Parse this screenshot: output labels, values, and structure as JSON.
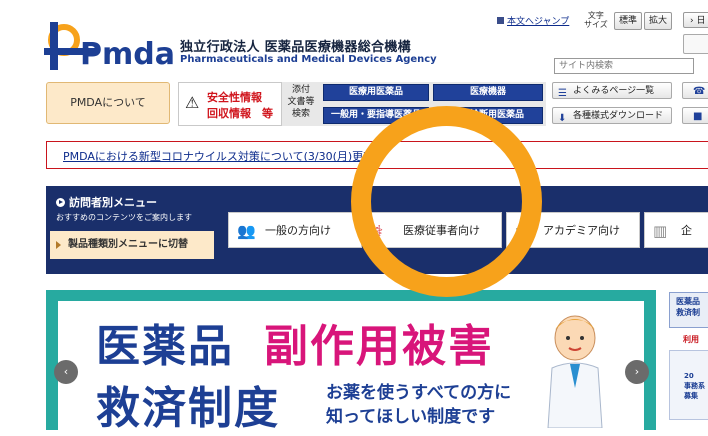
{
  "header": {
    "logo_text": "Pmda",
    "org_name_jp": "独立行政法人 医薬品医療機器総合機構",
    "org_name_en": "Pharmaceuticals and Medical Devices Agency",
    "skip_link": "本文へジャンプ",
    "font_size_label_1": "文字",
    "font_size_label_2": "サイズ",
    "font_standard": "標準",
    "font_large": "拡大",
    "language_button": "› 日",
    "search_placeholder": "サイト内検索"
  },
  "nav": {
    "about": "PMDAについて",
    "safety_line1": "安全性情報",
    "safety_line2": "回収情報　等",
    "doc_search_label_1": "添付",
    "doc_search_label_2": "文書等",
    "doc_search_label_3": "検索",
    "doc_buttons": [
      "医療用医薬品",
      "医療機器",
      "一般用・要指導医薬品",
      "体外診断用医薬品"
    ],
    "faq": "よくみるページ一覧",
    "downloads": "各種様式ダウンロード",
    "util_side_icons": [
      "phone-icon",
      "bus-icon"
    ]
  },
  "notice": {
    "text": "PMDAにおける新型コロナウイルス対策について(3/30(月)更新)"
  },
  "visitor_menu": {
    "title": "訪問者別メニュー",
    "subtitle": "おすすめのコンテンツをご案内します",
    "switch_label": "製品種類別メニューに切替",
    "buttons": [
      {
        "label": "一般の方向け",
        "icon": "people-icon"
      },
      {
        "label": "医療従事者向け",
        "icon": "stethoscope-icon"
      },
      {
        "label": "アカデミア向け",
        "icon": "graduate-icon"
      },
      {
        "label": "企",
        "icon": "building-icon"
      }
    ]
  },
  "banner": {
    "line1_a": "医薬品",
    "line1_b": "副作用被害",
    "line2_a": "救済制度",
    "line2_b1": "お薬を使うすべての方に",
    "line2_b2": "知ってほしい制度です",
    "prev": "‹",
    "next": "›"
  },
  "side_banner": {
    "title_1": "医薬品",
    "title_2": "救済制",
    "sub": "利用",
    "small_1": "20",
    "small_2": "事務系",
    "small_3": "募集"
  },
  "colors": {
    "brand_blue": "#1d3f94",
    "navy": "#1a2f6b",
    "accent_orange": "#f7a21b",
    "alert_red": "#d0141c",
    "banner_teal": "#27aaa0",
    "banner_pink": "#d8157a"
  }
}
